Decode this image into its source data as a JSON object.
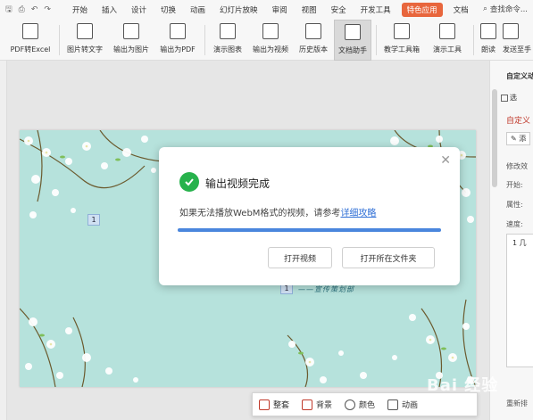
{
  "menubar": {
    "items": [
      "开始",
      "插入",
      "设计",
      "切换",
      "动画",
      "幻灯片放映",
      "审阅",
      "视图",
      "安全",
      "开发工具"
    ],
    "special": "特色应用",
    "more": "文档",
    "search": "查找命令..."
  },
  "ribbon": {
    "buttons": [
      {
        "label": "PDF转Excel",
        "icon": "pdf-excel-icon"
      },
      {
        "label": "图片转文字",
        "icon": "image-text-icon"
      },
      {
        "label": "输出为图片",
        "icon": "export-image-icon"
      },
      {
        "label": "输出为PDF",
        "icon": "export-pdf-icon"
      },
      {
        "label": "演示图表",
        "icon": "chart-icon"
      },
      {
        "label": "输出为视频",
        "icon": "export-video-icon"
      },
      {
        "label": "历史版本",
        "icon": "history-icon"
      },
      {
        "label": "文档助手",
        "icon": "doc-assistant-icon"
      },
      {
        "label": "教学工具箱",
        "icon": "teaching-icon"
      },
      {
        "label": "演示工具",
        "icon": "present-tools-icon"
      },
      {
        "label": "朗读",
        "icon": "read-aloud-icon"
      },
      {
        "label": "发送至手",
        "icon": "send-phone-icon"
      }
    ]
  },
  "right_panel": {
    "title": "自定义动",
    "select": "选",
    "custom": "自定义",
    "add": "添",
    "modify": "修改效",
    "start": "开始:",
    "property": "属性:",
    "speed": "速度:",
    "item": "1 几",
    "rearrange": "重新排"
  },
  "slide": {
    "badge1": "1",
    "badge2": "1",
    "subtitle": "——宣传策划部"
  },
  "dialog": {
    "title": "输出视频完成",
    "message": "如果无法播放WebM格式的视频，请参考",
    "link": "详细攻略",
    "progress": 1.0,
    "open_video": "打开视频",
    "open_folder": "打开所在文件夹"
  },
  "bottom_toolbar": {
    "items": [
      "整套",
      "背景",
      "颜色",
      "动画"
    ]
  },
  "watermark": "Bai 经验"
}
